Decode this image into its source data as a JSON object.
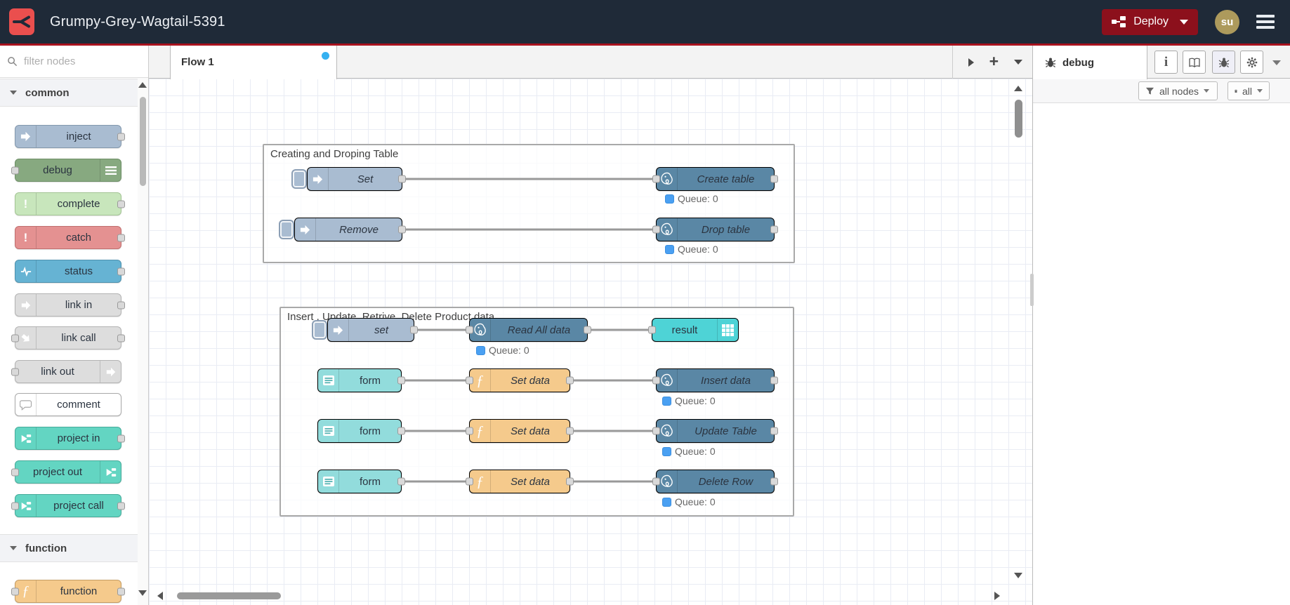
{
  "header": {
    "title": "Grumpy-Grey-Wagtail-5391",
    "deploy_label": "Deploy",
    "avatar_text": "su"
  },
  "palette": {
    "filter_placeholder": "filter nodes",
    "categories": [
      {
        "label": "common",
        "nodes": [
          {
            "label": "inject"
          },
          {
            "label": "debug"
          },
          {
            "label": "complete"
          },
          {
            "label": "catch"
          },
          {
            "label": "status"
          },
          {
            "label": "link in"
          },
          {
            "label": "link call"
          },
          {
            "label": "link out"
          },
          {
            "label": "comment"
          },
          {
            "label": "project in"
          },
          {
            "label": "project out"
          },
          {
            "label": "project call"
          }
        ]
      },
      {
        "label": "function",
        "nodes": [
          {
            "label": "function"
          }
        ]
      }
    ]
  },
  "flow": {
    "tab_label": "Flow 1",
    "groups": [
      {
        "label": "Creating and Droping Table"
      },
      {
        "label": "Insert , Update, Retrive, Delete Product data"
      }
    ],
    "nodes": [
      {
        "label": "Set"
      },
      {
        "label": "Create table"
      },
      {
        "label": "Remove"
      },
      {
        "label": "Drop table"
      },
      {
        "label": "set"
      },
      {
        "label": "Read All data"
      },
      {
        "label": "result"
      },
      {
        "label": "form"
      },
      {
        "label": "Set data"
      },
      {
        "label": "Insert data"
      },
      {
        "label": "form"
      },
      {
        "label": "Set data"
      },
      {
        "label": "Update Table"
      },
      {
        "label": "form"
      },
      {
        "label": "Set data"
      },
      {
        "label": "Delete Row"
      }
    ],
    "status_text": "Queue: 0"
  },
  "sidebar": {
    "tab_label": "debug",
    "filter_label": "all nodes",
    "clear_label": "all"
  },
  "colors": {
    "header_bg": "#1F2A38",
    "accent_red": "#A8121E",
    "deploy_red": "#8C101C",
    "logo_red": "#EA4F4E",
    "inject_node": "#a9bcd1",
    "postgres_node": "#5a87a5",
    "function_node": "#f5ca8c",
    "form_node": "#92dcdc",
    "result_node": "#4ed3d6",
    "project_node": "#63d5c2",
    "status_dot_blue": "#4aa0f2",
    "modified_dot_blue": "#35b1f1"
  }
}
